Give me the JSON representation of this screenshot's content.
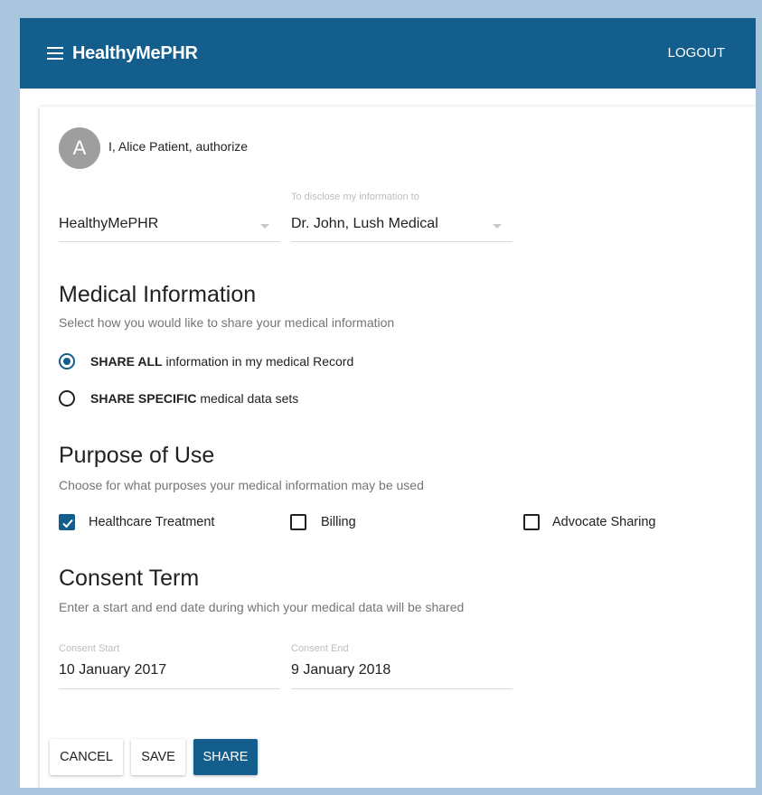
{
  "app": {
    "title": "HealthyMePHR",
    "logout_label": "LOGOUT"
  },
  "consent": {
    "avatar_letter": "A",
    "authorize_text": "I, Alice Patient, authorize",
    "from_value": "HealthyMePHR",
    "to_label": "To disclose my information to",
    "to_value": "Dr. John, Lush Medical"
  },
  "medical": {
    "title": "Medical Information",
    "subtitle": "Select how you would like to share your medical information",
    "options": [
      {
        "bold": "SHARE ALL",
        "rest": " information in my medical Record",
        "checked": true
      },
      {
        "bold": "SHARE SPECIFIC",
        "rest": " medical data sets",
        "checked": false
      }
    ]
  },
  "purpose": {
    "title": "Purpose of Use",
    "subtitle": "Choose for what purposes your medical information may be used",
    "options": [
      {
        "label": "Healthcare Treatment",
        "checked": true
      },
      {
        "label": "Billing",
        "checked": false
      },
      {
        "label": "Advocate Sharing",
        "checked": false
      }
    ]
  },
  "term": {
    "title": "Consent Term",
    "subtitle": "Enter a start and end date during which your medical data will be shared",
    "start_label": "Consent Start",
    "start_value": "10 January 2017",
    "end_label": "Consent End",
    "end_value": "9 January 2018"
  },
  "actions": {
    "cancel": "CANCEL",
    "save": "SAVE",
    "share": "SHARE"
  },
  "colors": {
    "primary": "#135e8c",
    "backdrop": "#a9c6de"
  },
  "icons": [
    "menu-icon",
    "dropdown-arrow-icon",
    "checkmark-icon"
  ]
}
